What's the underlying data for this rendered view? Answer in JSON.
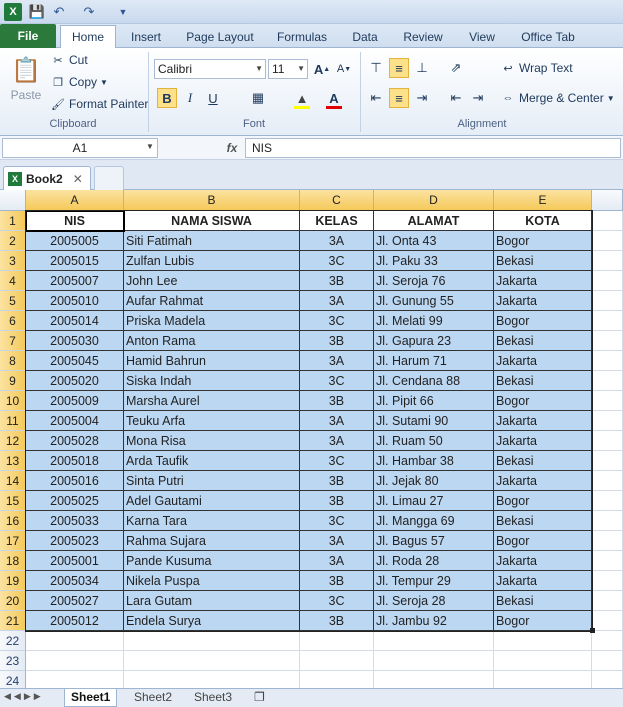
{
  "quick_access": {
    "save_icon": "save-icon",
    "undo_icon": "undo-icon",
    "redo_icon": "redo-icon"
  },
  "ribbon_tabs": [
    "File",
    "Home",
    "Insert",
    "Page Layout",
    "Formulas",
    "Data",
    "Review",
    "View",
    "Office Tab"
  ],
  "clipboard": {
    "paste": "Paste",
    "cut": "Cut",
    "copy": "Copy",
    "format_painter": "Format Painter",
    "label": "Clipboard"
  },
  "font": {
    "name": "Calibri",
    "size": "11",
    "bold": "B",
    "italic": "I",
    "underline": "U",
    "label": "Font"
  },
  "alignment": {
    "wrap_text": "Wrap Text",
    "merge_center": "Merge & Center",
    "label": "Alignment"
  },
  "formula_bar": {
    "name_box": "A1",
    "fx": "fx",
    "value": "NIS"
  },
  "workbook_tab": "Book2",
  "columns": [
    "A",
    "B",
    "C",
    "D",
    "E"
  ],
  "table": {
    "headers": [
      "NIS",
      "NAMA SISWA",
      "KELAS",
      "ALAMAT",
      "KOTA"
    ],
    "rows": [
      [
        "2005005",
        "Siti Fatimah",
        "3A",
        "Jl. Onta 43",
        "Bogor"
      ],
      [
        "2005015",
        "Zulfan Lubis",
        "3C",
        "Jl. Paku 33",
        "Bekasi"
      ],
      [
        "2005007",
        "John Lee",
        "3B",
        "Jl. Seroja 76",
        "Jakarta"
      ],
      [
        "2005010",
        "Aufar Rahmat",
        "3A",
        "Jl. Gunung 55",
        "Jakarta"
      ],
      [
        "2005014",
        "Priska Madela",
        "3C",
        "Jl. Melati 99",
        "Bogor"
      ],
      [
        "2005030",
        "Anton Rama",
        "3B",
        "Jl. Gapura 23",
        "Bekasi"
      ],
      [
        "2005045",
        "Hamid Bahrun",
        "3A",
        "Jl. Harum 71",
        "Jakarta"
      ],
      [
        "2005020",
        "Siska Indah",
        "3C",
        "Jl. Cendana 88",
        "Bekasi"
      ],
      [
        "2005009",
        "Marsha Aurel",
        "3B",
        "Jl. Pipit 66",
        "Bogor"
      ],
      [
        "2005004",
        "Teuku Arfa",
        "3A",
        "Jl. Sutami 90",
        "Jakarta"
      ],
      [
        "2005028",
        "Mona Risa",
        "3A",
        "Jl. Ruam 50",
        "Jakarta"
      ],
      [
        "2005018",
        "Arda Taufik",
        "3C",
        "Jl. Hambar 38",
        "Bekasi"
      ],
      [
        "2005016",
        "Sinta Putri",
        "3B",
        "Jl. Jejak 80",
        "Jakarta"
      ],
      [
        "2005025",
        "Adel Gautami",
        "3B",
        "Jl. Limau 27",
        "Bogor"
      ],
      [
        "2005033",
        "Karna Tara",
        "3C",
        "Jl. Mangga 69",
        "Bekasi"
      ],
      [
        "2005023",
        "Rahma Sujara",
        "3A",
        "Jl. Bagus 57",
        "Bogor"
      ],
      [
        "2005001",
        "Pande Kusuma",
        "3A",
        "Jl. Roda 28",
        "Jakarta"
      ],
      [
        "2005034",
        "Nikela Puspa",
        "3B",
        "Jl. Tempur 29",
        "Jakarta"
      ],
      [
        "2005027",
        "Lara Gutam",
        "3C",
        "Jl. Seroja 28",
        "Bekasi"
      ],
      [
        "2005012",
        "Endela Surya",
        "3B",
        "Jl. Jambu 92",
        "Bogor"
      ]
    ]
  },
  "row_numbers": [
    "1",
    "2",
    "3",
    "4",
    "5",
    "6",
    "7",
    "8",
    "9",
    "10",
    "11",
    "12",
    "13",
    "14",
    "15",
    "16",
    "17",
    "18",
    "19",
    "20",
    "21",
    "22",
    "23",
    "24"
  ],
  "sheets": [
    "Sheet1",
    "Sheet2",
    "Sheet3"
  ],
  "colors": {
    "selection_fill": "#bcd7f2",
    "header_fill": "#ffffff",
    "file_tab": "#2b7a3b",
    "header_highlight": "#f5c95a"
  }
}
